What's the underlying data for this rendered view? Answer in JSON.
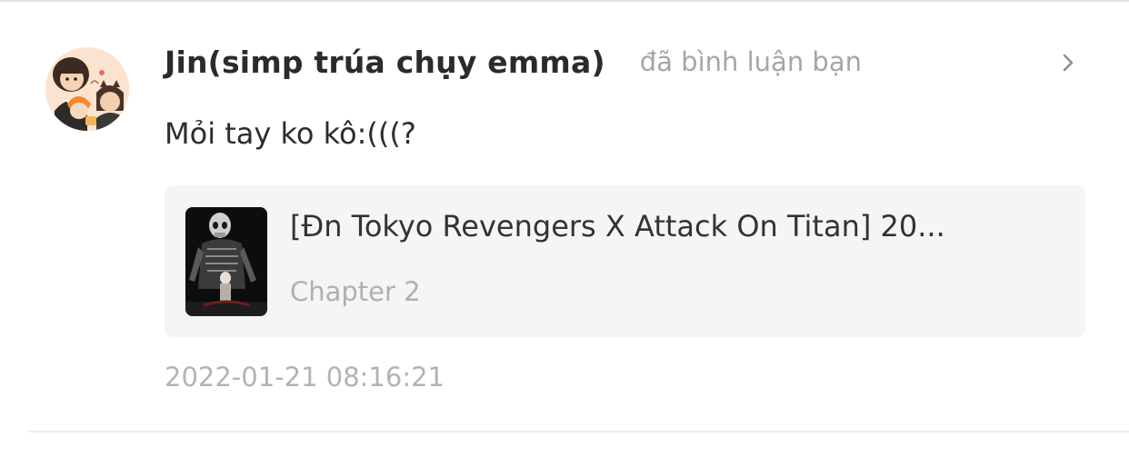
{
  "notification": {
    "username": "Jin(simp trúa chụy emma)",
    "action": "đã bình luận bạn",
    "comment": "Mỏi tay ko kô:(((?",
    "timestamp": "2022-01-21 08:16:21",
    "chevron_icon": "chevron-right-icon",
    "avatar_icon": "user-avatar"
  },
  "story": {
    "title": "[Đn Tokyo Revengers X Attack On Titan] 20...",
    "chapter": "Chapter 2",
    "cover_icon": "story-cover-image"
  },
  "colors": {
    "username": "#2b2b2b",
    "secondary_text": "#a6a6a6",
    "card_background": "#f5f5f5",
    "divider": "#e4e4e4"
  }
}
